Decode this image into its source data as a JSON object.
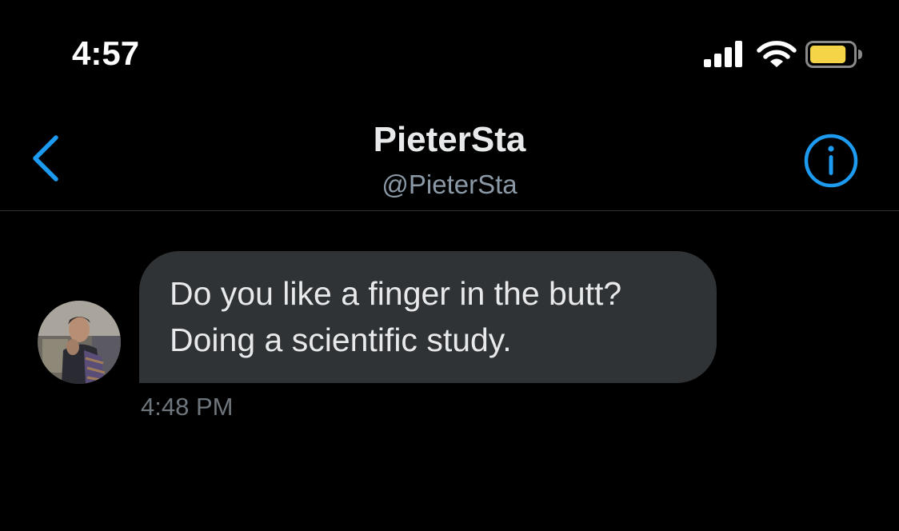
{
  "status_bar": {
    "time": "4:57",
    "icons": [
      "signal-bars-icon",
      "wifi-icon",
      "battery-icon"
    ],
    "battery_color": "#f5d547",
    "battery_level": 0.85
  },
  "header": {
    "back_icon": "chevron-left-icon",
    "title": "PieterSta",
    "handle": "@PieterSta",
    "info_icon": "info-circle-icon"
  },
  "conversation": {
    "messages": [
      {
        "lines": [
          "Do you like a finger in the butt?",
          "Doing a scientific study."
        ],
        "time": "4:48 PM",
        "avatar_icon": "user-avatar"
      }
    ]
  },
  "colors": {
    "background": "#000000",
    "accent": "#1d9bf0",
    "bubble": "#2f3336",
    "title_text": "#e7e9ea",
    "secondary_text": "#8b98a5",
    "timestamp_text": "#6e767d",
    "divider": "#2f3336"
  }
}
